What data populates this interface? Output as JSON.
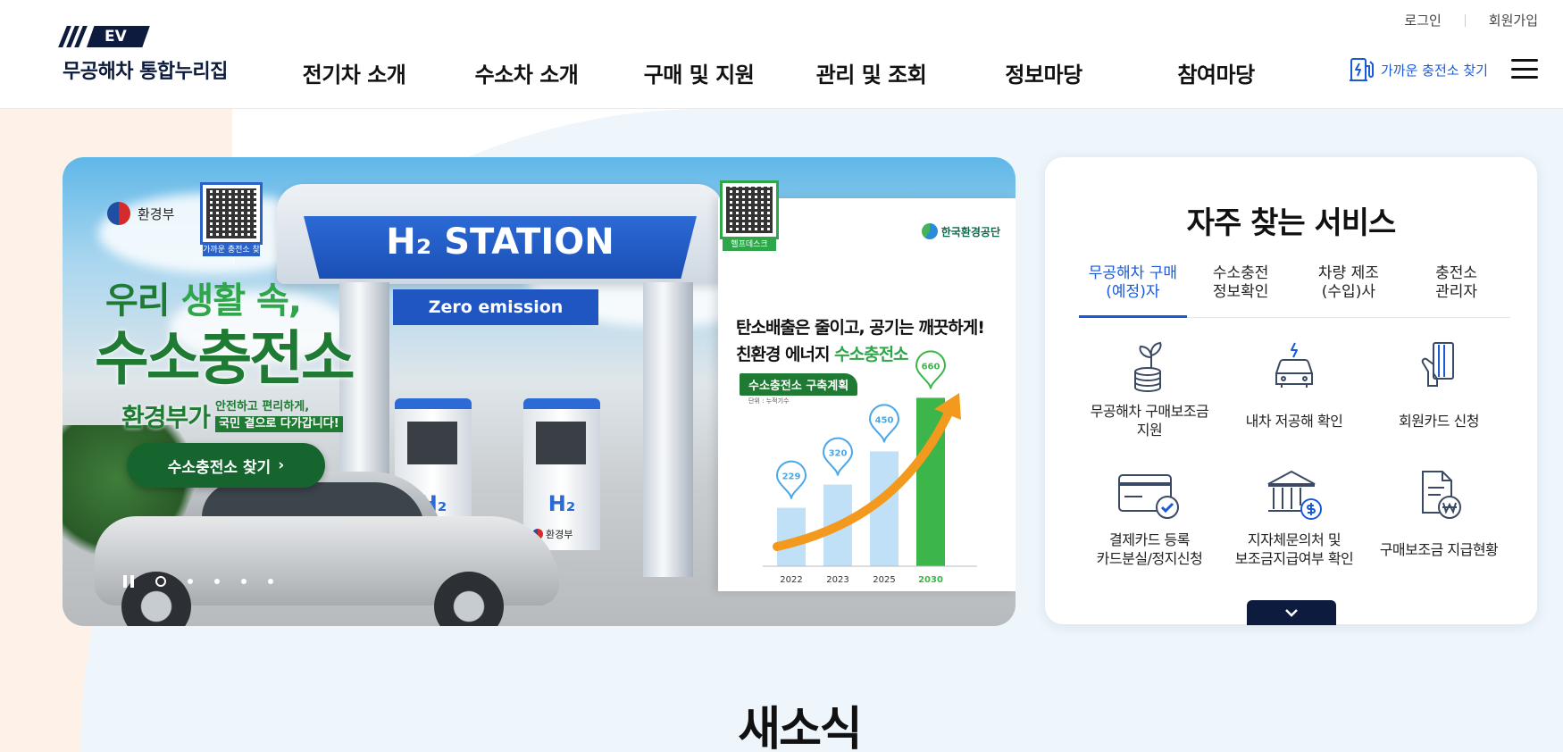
{
  "header": {
    "logo_badge": "EV",
    "logo_text": "무공해차 통합누리집",
    "util": {
      "login": "로그인",
      "signup": "회원가입"
    },
    "nav": [
      "전기차 소개",
      "수소차 소개",
      "구매 및 지원",
      "관리 및 조회",
      "정보마당",
      "참여마당"
    ],
    "charger_link": "가까운 충전소 찾기",
    "charger_icon": "charger-icon",
    "menu_icon": "hamburger-icon"
  },
  "banner": {
    "ministry": "환경부",
    "qr1_caption": "가까운 충전소 찾기",
    "qr2_caption": "헬프데스크",
    "headline_1a": "우리 ",
    "headline_1b": "생활 속,",
    "headline_2": "수소충전소",
    "headline_3_big": "환경부가",
    "headline_3_small_1": "안전하고 편리하게,",
    "headline_3_small_2": "국민 곁으로 다가갑니다!",
    "cta": "수소충전소 찾기",
    "station_title": "H₂ STATION",
    "station_sub": "Zero emission",
    "pump_label": "H₂",
    "pump_ministry": "환경부",
    "org": "한국환경공단",
    "info_line1": "탄소배출은 줄이고, 공기는 깨끗하게!",
    "info_line2a": "친환경 에너지 ",
    "info_line2b": "수소충전소",
    "plan_label": "수소충전소 구축계획",
    "unit": "단위 : 누적기수",
    "accent_green": "#1f7a33",
    "slides_total": 5,
    "slide_active": 1
  },
  "chart_data": {
    "type": "bar",
    "categories": [
      "2022",
      "2023",
      "2025",
      "2030"
    ],
    "values": [
      229,
      320,
      450,
      660
    ],
    "title": "수소충전소 구축계획",
    "ylabel": "단위 : 누적기수",
    "ylim": [
      0,
      700
    ],
    "colors": {
      "default": "#bfe0f7",
      "highlight": "#3cb54a",
      "marker_default": "#4aa8e8",
      "marker_highlight": "#3cb54a"
    }
  },
  "services": {
    "title": "자주 찾는 서비스",
    "tabs": [
      {
        "line1": "무공해차 구매",
        "line2": "(예정)자",
        "active": true
      },
      {
        "line1": "수소충전",
        "line2": "정보확인",
        "active": false
      },
      {
        "line1": "차량 제조",
        "line2": "(수입)사",
        "active": false
      },
      {
        "line1": "충전소",
        "line2": "관리자",
        "active": false
      }
    ],
    "items": [
      {
        "label": "무공해차 구매보조금\n지원",
        "icon": "coins-plant-icon"
      },
      {
        "label": "내차 저공해 확인",
        "icon": "electric-car-icon"
      },
      {
        "label": "회원카드 신청",
        "icon": "card-hand-icon"
      },
      {
        "label": "결제카드 등록\n카드분실/정지신청",
        "icon": "credit-card-check-icon"
      },
      {
        "label": "지자체문의처 및\n보조금지급여부 확인",
        "icon": "government-building-icon"
      },
      {
        "label": "구매보조금 지급현황",
        "icon": "document-won-icon"
      }
    ],
    "more_icon": "chevron-down-icon"
  },
  "news": {
    "title": "새소식"
  }
}
